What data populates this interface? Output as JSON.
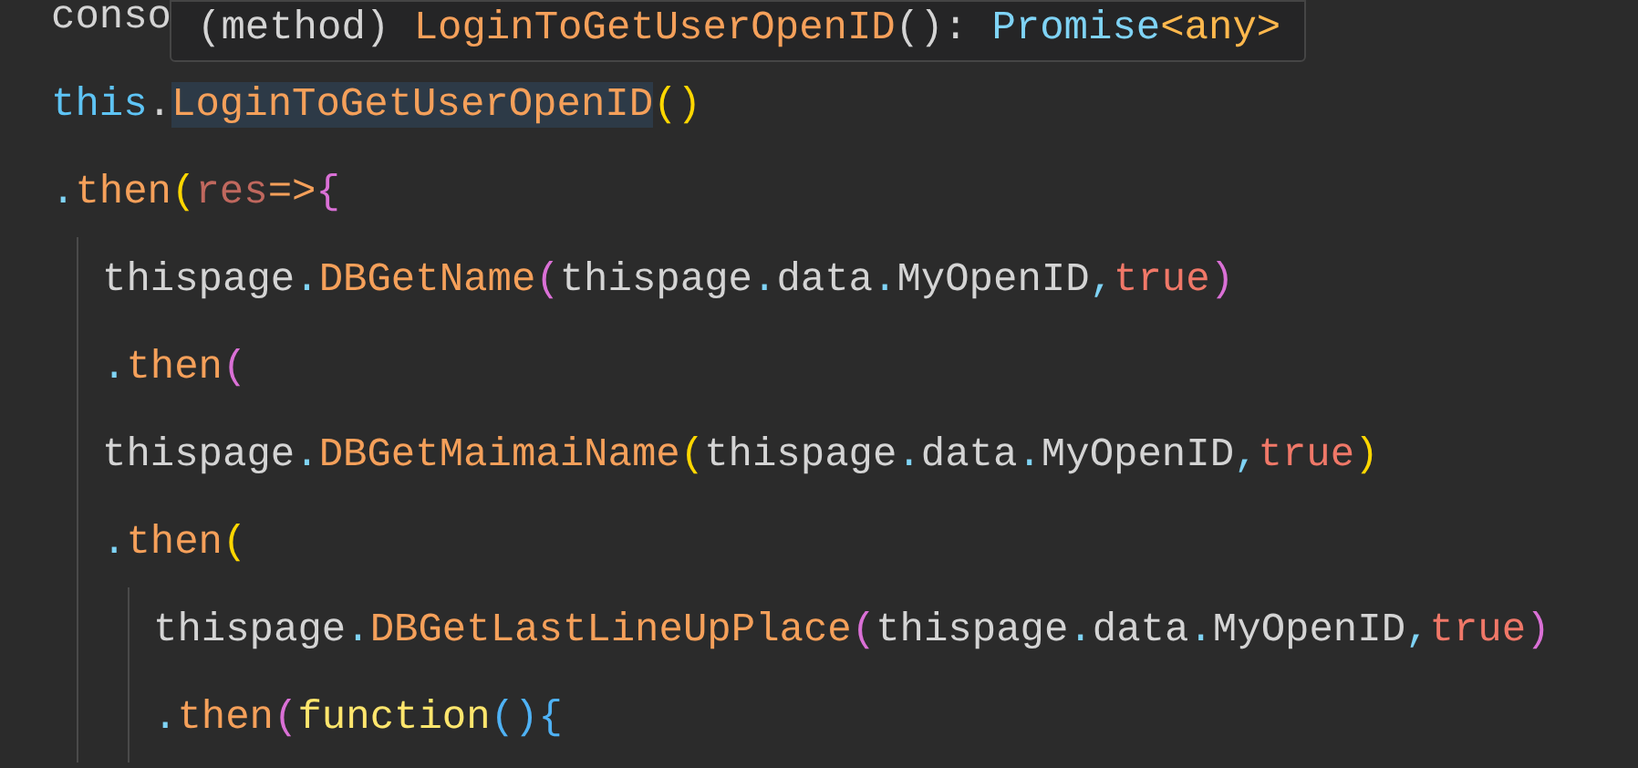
{
  "tooltip": {
    "tokens": [
      {
        "text": "(method) ",
        "kind": "plain"
      },
      {
        "text": "LoginToGetUserOpenID",
        "kind": "method"
      },
      {
        "text": "(): ",
        "kind": "plain"
      },
      {
        "text": "Promise",
        "kind": "type"
      },
      {
        "text": "<any>",
        "kind": "keyword-orange"
      }
    ]
  },
  "lines": [
    {
      "tokens": [
        {
          "text": "conso",
          "kind": "plain"
        }
      ]
    },
    {
      "tokens": [
        {
          "text": "this",
          "kind": "this"
        },
        {
          "text": ".",
          "kind": "plain"
        },
        {
          "text": "LoginToGetUserOpenID",
          "kind": "method",
          "highlighted": true
        },
        {
          "text": "()",
          "kind": "paren1"
        }
      ]
    },
    {
      "tokens": [
        {
          "text": ".",
          "kind": "dot"
        },
        {
          "text": "then",
          "kind": "method"
        },
        {
          "text": "(",
          "kind": "paren1"
        },
        {
          "text": "res",
          "kind": "param"
        },
        {
          "text": "=>",
          "kind": "arrow"
        },
        {
          "text": "{",
          "kind": "paren2"
        }
      ],
      "children": [
        {
          "tokens": [
            {
              "text": "thispage",
              "kind": "plain"
            },
            {
              "text": ".",
              "kind": "dot"
            },
            {
              "text": "DBGetName",
              "kind": "method"
            },
            {
              "text": "(",
              "kind": "paren2"
            },
            {
              "text": "thispage",
              "kind": "plain"
            },
            {
              "text": ".",
              "kind": "dot"
            },
            {
              "text": "data",
              "kind": "plain"
            },
            {
              "text": ".",
              "kind": "dot"
            },
            {
              "text": "MyOpenID",
              "kind": "plain"
            },
            {
              "text": ",",
              "kind": "dot"
            },
            {
              "text": "true",
              "kind": "bool"
            },
            {
              "text": ")",
              "kind": "paren2"
            }
          ]
        },
        {
          "tokens": [
            {
              "text": ".",
              "kind": "dot"
            },
            {
              "text": "then",
              "kind": "method"
            },
            {
              "text": "(",
              "kind": "paren2"
            }
          ]
        },
        {
          "tokens": [
            {
              "text": "thispage",
              "kind": "plain"
            },
            {
              "text": ".",
              "kind": "dot"
            },
            {
              "text": "DBGetMaimaiName",
              "kind": "method"
            },
            {
              "text": "(",
              "kind": "paren1"
            },
            {
              "text": "thispage",
              "kind": "plain"
            },
            {
              "text": ".",
              "kind": "dot"
            },
            {
              "text": "data",
              "kind": "plain"
            },
            {
              "text": ".",
              "kind": "dot"
            },
            {
              "text": "MyOpenID",
              "kind": "plain"
            },
            {
              "text": ",",
              "kind": "dot"
            },
            {
              "text": "true",
              "kind": "bool"
            },
            {
              "text": ")",
              "kind": "paren1"
            }
          ]
        },
        {
          "tokens": [
            {
              "text": ".",
              "kind": "dot"
            },
            {
              "text": "then",
              "kind": "method"
            },
            {
              "text": "(",
              "kind": "paren1"
            }
          ],
          "children": [
            {
              "tokens": [
                {
                  "text": "thispage",
                  "kind": "plain"
                },
                {
                  "text": ".",
                  "kind": "dot"
                },
                {
                  "text": "DBGetLastLineUpPlace",
                  "kind": "method"
                },
                {
                  "text": "(",
                  "kind": "paren2"
                },
                {
                  "text": "thispage",
                  "kind": "plain"
                },
                {
                  "text": ".",
                  "kind": "dot"
                },
                {
                  "text": "data",
                  "kind": "plain"
                },
                {
                  "text": ".",
                  "kind": "dot"
                },
                {
                  "text": "MyOpenID",
                  "kind": "plain"
                },
                {
                  "text": ",",
                  "kind": "dot"
                },
                {
                  "text": "true",
                  "kind": "bool"
                },
                {
                  "text": ")",
                  "kind": "paren2"
                }
              ]
            },
            {
              "tokens": [
                {
                  "text": ".",
                  "kind": "dot"
                },
                {
                  "text": "then",
                  "kind": "method"
                },
                {
                  "text": "(",
                  "kind": "paren2"
                },
                {
                  "text": "function",
                  "kind": "function"
                },
                {
                  "text": "()",
                  "kind": "paren3"
                },
                {
                  "text": "{",
                  "kind": "paren3"
                }
              ]
            }
          ]
        }
      ]
    }
  ]
}
